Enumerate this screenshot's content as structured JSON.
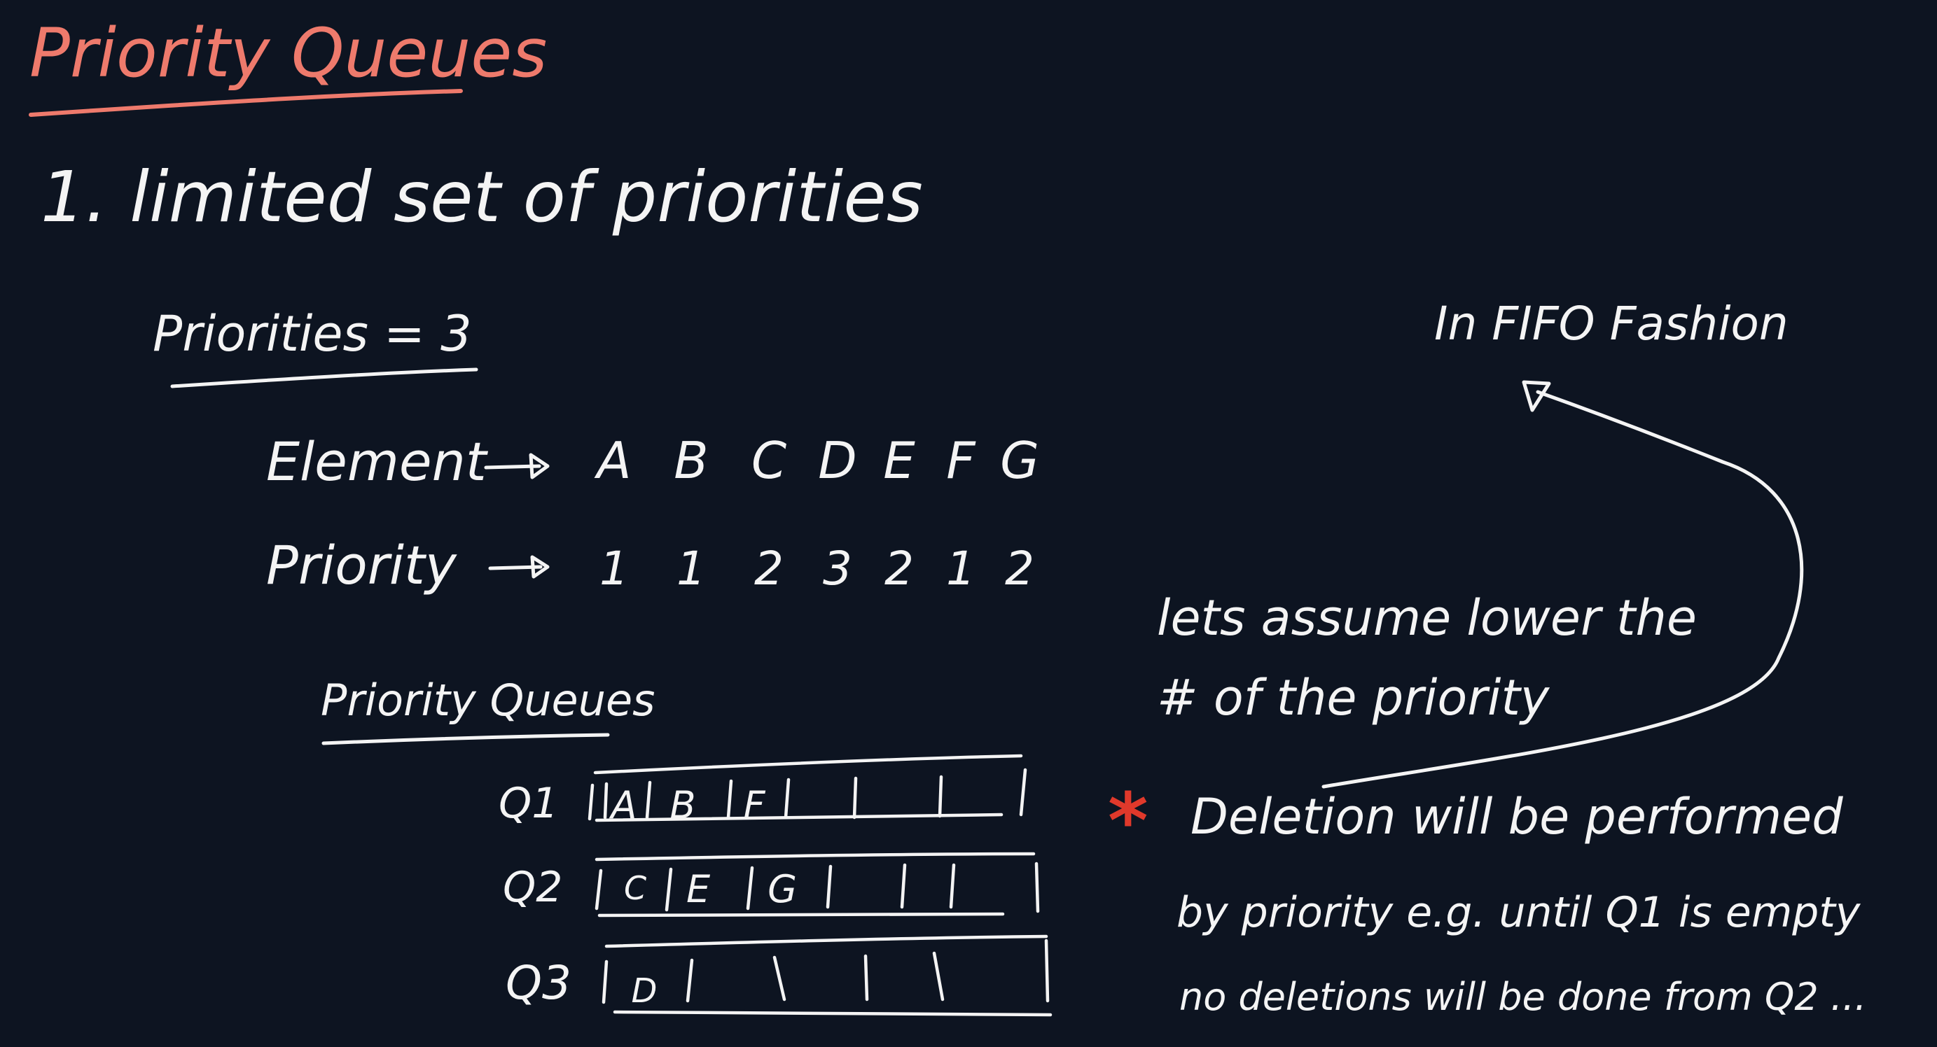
{
  "title": "Priority Queues",
  "heading": "1. limited set of priorities",
  "priorities_label": "Priorities = 3",
  "element_label": "Element",
  "priority_label": "Priority",
  "elements": [
    "A",
    "B",
    "C",
    "D",
    "E",
    "F",
    "G"
  ],
  "priority_values": [
    "1",
    "1",
    "2",
    "3",
    "2",
    "1",
    "2"
  ],
  "queues_label": "Priority Queues",
  "queues": [
    {
      "label": "Q1",
      "items": [
        "A",
        "B",
        "F"
      ]
    },
    {
      "label": "Q2",
      "items": [
        "C",
        "E",
        "G"
      ]
    },
    {
      "label": "Q3",
      "items": [
        "D"
      ]
    }
  ],
  "fifo_note": "In FIFO Fashion",
  "assume_note_line1": "lets assume lower the",
  "assume_note_line2": "# of the priority",
  "deletion_star": "*",
  "deletion_line1": "Deletion will be performed",
  "deletion_line2": "by priority e.g. until Q1 is empty",
  "deletion_line3": "no deletions will be done from Q2 ...",
  "colors": {
    "background": "#0d1421",
    "ink": "#f4f4f4",
    "title": "#ee7a6c",
    "star": "#e0392b"
  }
}
